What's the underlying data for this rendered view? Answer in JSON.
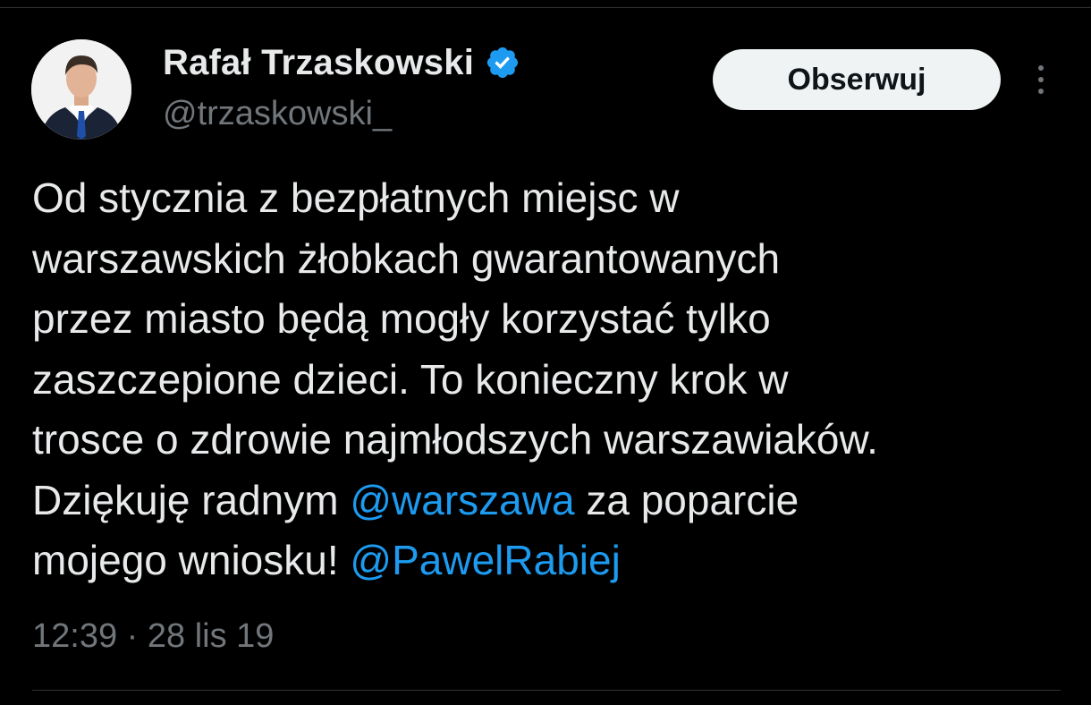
{
  "author": {
    "display_name": "Rafał Trzaskowski",
    "handle": "@trzaskowski_",
    "verified": true,
    "avatar_icon": "profile-photo"
  },
  "actions": {
    "follow_label": "Obserwuj",
    "more_icon": "more-vertical-icon"
  },
  "tweet": {
    "lines": [
      {
        "text": "Od stycznia z bezpłatnych miejsc w"
      },
      {
        "text": "warszawskich żłobkach gwarantowanych"
      },
      {
        "text": "przez miasto będą mogły korzystać tylko"
      },
      {
        "text": "zaszczepione dzieci. To konieczny krok w"
      },
      {
        "text": "trosce o zdrowie najmłodszych warszawiaków."
      },
      {
        "before": "Dziękuję radnym ",
        "mention": "@warszawa",
        "after": " za poparcie"
      },
      {
        "before": "mojego wniosku! ",
        "mention": "@PawelRabiej",
        "after": ""
      }
    ],
    "timestamp": "12:39 · 28 lis 19"
  },
  "colors": {
    "background": "#000000",
    "text_primary": "#e7e9ea",
    "text_secondary": "#71767b",
    "link": "#1d9bf0",
    "verified_badge": "#1d9bf0",
    "button_bg": "#eff3f4",
    "divider": "#2f3336"
  }
}
